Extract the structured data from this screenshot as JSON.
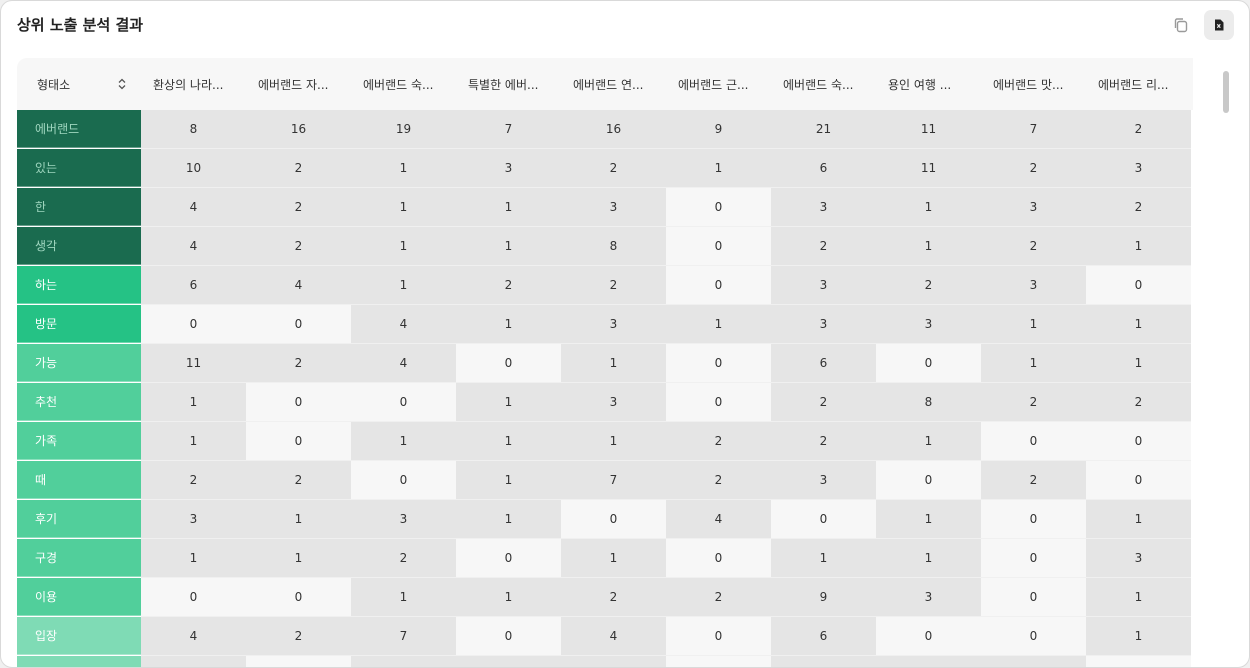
{
  "panel": {
    "title": "상위 노출 분석 결과"
  },
  "table": {
    "row_header_label": "형태소",
    "columns": [
      "환상의 나라...",
      "에버랜드 자...",
      "에버랜드 숙...",
      "특별한 에버...",
      "에버랜드 연...",
      "에버랜드 근...",
      "에버랜드 숙...",
      "용인 여행 ...",
      "에버랜드 맛...",
      "에버랜드 리..."
    ],
    "rows": [
      {
        "label": "에버랜드",
        "values": [
          8,
          16,
          19,
          7,
          16,
          9,
          21,
          11,
          7,
          2
        ]
      },
      {
        "label": "있는",
        "values": [
          10,
          2,
          1,
          3,
          2,
          1,
          6,
          11,
          2,
          3
        ]
      },
      {
        "label": "한",
        "values": [
          4,
          2,
          1,
          1,
          3,
          0,
          3,
          1,
          3,
          2
        ]
      },
      {
        "label": "생각",
        "values": [
          4,
          2,
          1,
          1,
          8,
          0,
          2,
          1,
          2,
          1
        ]
      },
      {
        "label": "하는",
        "values": [
          6,
          4,
          1,
          2,
          2,
          0,
          3,
          2,
          3,
          0
        ]
      },
      {
        "label": "방문",
        "values": [
          0,
          0,
          4,
          1,
          3,
          1,
          3,
          3,
          1,
          1
        ]
      },
      {
        "label": "가능",
        "values": [
          11,
          2,
          4,
          0,
          1,
          0,
          6,
          0,
          1,
          1
        ]
      },
      {
        "label": "추천",
        "values": [
          1,
          0,
          0,
          1,
          3,
          0,
          2,
          8,
          2,
          2
        ]
      },
      {
        "label": "가족",
        "values": [
          1,
          0,
          1,
          1,
          1,
          2,
          2,
          1,
          0,
          0
        ]
      },
      {
        "label": "때",
        "values": [
          2,
          2,
          0,
          1,
          7,
          2,
          3,
          0,
          2,
          0
        ]
      },
      {
        "label": "후기",
        "values": [
          3,
          1,
          3,
          1,
          0,
          4,
          0,
          1,
          0,
          1
        ]
      },
      {
        "label": "구경",
        "values": [
          1,
          1,
          2,
          0,
          1,
          0,
          1,
          1,
          0,
          3
        ]
      },
      {
        "label": "이용",
        "values": [
          0,
          0,
          1,
          1,
          2,
          2,
          9,
          3,
          0,
          1
        ]
      },
      {
        "label": "입장",
        "values": [
          4,
          2,
          7,
          0,
          4,
          0,
          6,
          0,
          0,
          1
        ]
      },
      {
        "label": "",
        "values": [
          null,
          null,
          null,
          null,
          null,
          null,
          null,
          null,
          null,
          null
        ]
      }
    ]
  },
  "colors": {
    "label_dark": "#1a6b4f",
    "label_bright": "#25c285",
    "label_mid": "#51cf9b",
    "label_light": "#7fdbb5",
    "cell_filled": "#e5e5e5",
    "cell_zero": "#f7f7f7",
    "header_bg": "#f7f7f7"
  },
  "icons": {
    "copy": "copy-icon",
    "export": "file-export-icon",
    "sort": "sort-icon"
  }
}
